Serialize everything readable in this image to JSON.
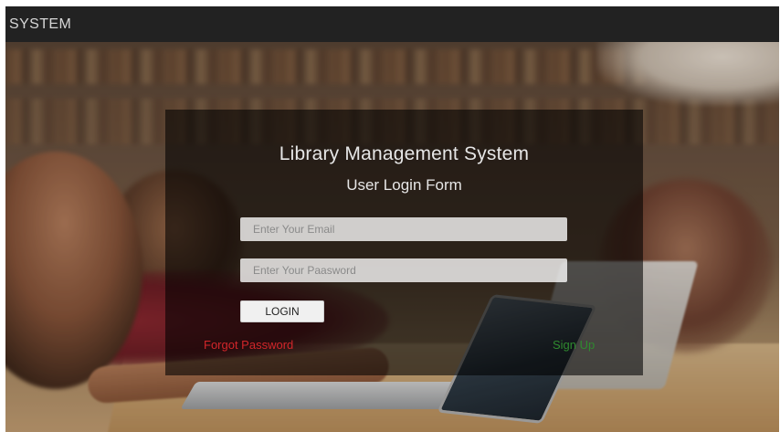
{
  "navbar": {
    "brand": "SYSTEM"
  },
  "login": {
    "title": "Library Management System",
    "subtitle": "User Login Form",
    "email": {
      "placeholder": "Enter Your Email",
      "value": ""
    },
    "password": {
      "placeholder": "Enter Your Paasword",
      "value": ""
    },
    "login_label": "LOGIN",
    "forgot_label": "Forgot Password",
    "signup_label": "Sign Up"
  },
  "colors": {
    "navbar_bg": "#222222",
    "panel_bg": "rgba(0,0,0,0.58)",
    "forgot_link": "#d2262a",
    "signup_link": "#2f8a2f"
  }
}
